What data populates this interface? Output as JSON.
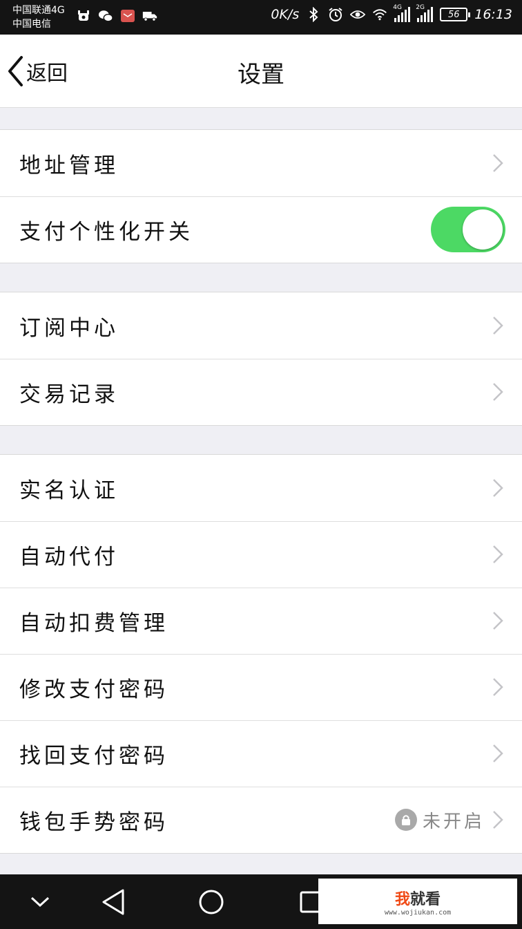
{
  "status_bar": {
    "carrier_1": "中国联通4G",
    "carrier_2": "中国电信",
    "speed": "0K/s",
    "signal_1_label": "4G",
    "signal_2_label": "2G",
    "battery": "56",
    "time": "16:13"
  },
  "nav": {
    "back_label": "返回",
    "title": "设置"
  },
  "groups": [
    {
      "items": [
        {
          "label": "地址管理",
          "control": "chevron"
        },
        {
          "label": "支付个性化开关",
          "control": "toggle",
          "on": true
        }
      ]
    },
    {
      "items": [
        {
          "label": "订阅中心",
          "control": "chevron"
        },
        {
          "label": "交易记录",
          "control": "chevron"
        }
      ]
    },
    {
      "items": [
        {
          "label": "实名认证",
          "control": "chevron"
        },
        {
          "label": "自动代付",
          "control": "chevron"
        },
        {
          "label": "自动扣费管理",
          "control": "chevron"
        },
        {
          "label": "修改支付密码",
          "control": "chevron"
        },
        {
          "label": "找回支付密码",
          "control": "chevron"
        },
        {
          "label": "钱包手势密码",
          "control": "chevron",
          "status": "未开启"
        }
      ]
    }
  ],
  "colors": {
    "toggle_on": "#4cd964",
    "status_bar_bg": "#141414",
    "page_bg": "#efeff4"
  },
  "watermark": {
    "brand_accent": "我",
    "brand_rest": "就看",
    "url": "www.wojiukan.com"
  }
}
